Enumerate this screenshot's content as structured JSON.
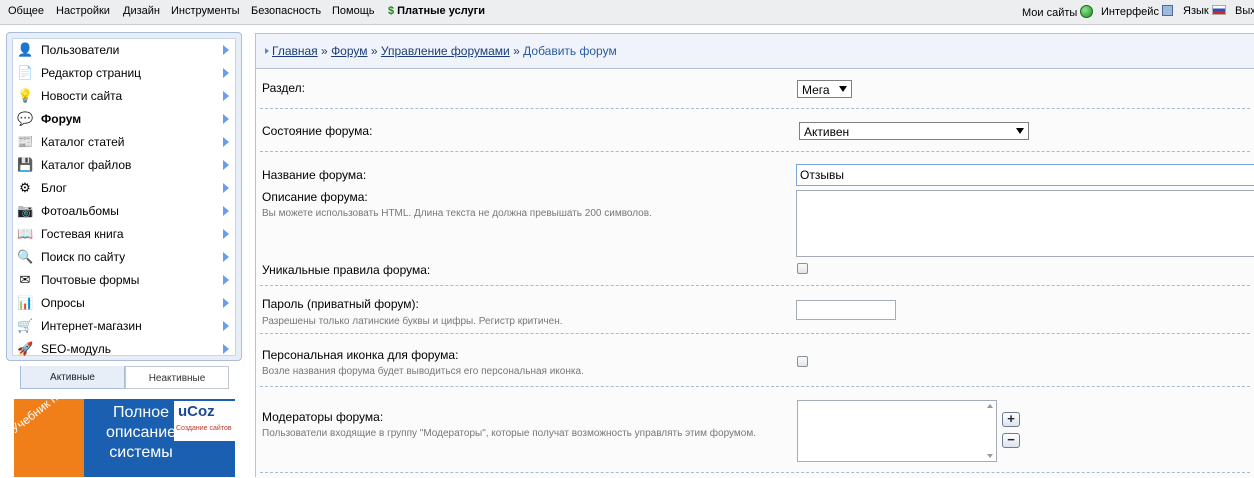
{
  "topmenu": {
    "items": [
      "Общее",
      "Настройки",
      "Дизайн",
      "Инструменты",
      "Безопасность",
      "Помощь"
    ],
    "paid": "Платные услуги",
    "mysites": "Мои сайты",
    "interface": "Интерфейс",
    "lang": "Язык",
    "exit": "Вых"
  },
  "sidebar": {
    "items": [
      {
        "label": "Пользователи",
        "icon": "👤"
      },
      {
        "label": "Редактор страниц",
        "icon": "📄"
      },
      {
        "label": "Новости сайта",
        "icon": "💡"
      },
      {
        "label": "Форум",
        "icon": "💬"
      },
      {
        "label": "Каталог статей",
        "icon": "📰"
      },
      {
        "label": "Каталог файлов",
        "icon": "💾"
      },
      {
        "label": "Блог",
        "icon": "⚙"
      },
      {
        "label": "Фотоальбомы",
        "icon": "📷"
      },
      {
        "label": "Гостевая книга",
        "icon": "📖"
      },
      {
        "label": "Поиск по сайту",
        "icon": "🔍"
      },
      {
        "label": "Почтовые формы",
        "icon": "✉"
      },
      {
        "label": "Опросы",
        "icon": "📊"
      },
      {
        "label": "Интернет-магазин",
        "icon": "🛒"
      },
      {
        "label": "SEO-модуль",
        "icon": "🚀"
      }
    ],
    "active_index": 3,
    "tab_active": "Активные",
    "tab_inactive": "Неактивные"
  },
  "banner": {
    "ribbon": "Учебник по uCoz",
    "line1": "Полное",
    "line2": "описание",
    "line3": "системы",
    "brand": "uCoz",
    "brand_sub": "Создание сайтов"
  },
  "breadcrumb": {
    "home": "Главная",
    "forum": "Форум",
    "manage": "Управление форумами",
    "current": "Добавить форум",
    "sep": "»"
  },
  "form": {
    "section_label": "Раздел:",
    "section_value": "Мега",
    "state_label": "Состояние форума:",
    "state_value": "Активен",
    "name_label": "Название форума:",
    "name_value": "Отзывы",
    "desc_label": "Описание форума:",
    "desc_hint": "Вы можете использовать HTML. Длина текста не должна превышать 200 символов.",
    "rules_label": "Уникальные правила форума:",
    "password_label": "Пароль (приватный форум):",
    "password_hint": "Разрешены только латинские буквы и цифры. Регистр критичен.",
    "icon_label": "Персональная иконка для форума:",
    "icon_hint": "Возле названия форума будет выводиться его персональная иконка.",
    "moderators_label": "Модераторы форума:",
    "moderators_hint": "Пользователи входящие в группу \"Модераторы\", которые получат возможность управлять этим форумом.",
    "plus": "+",
    "minus": "−"
  }
}
